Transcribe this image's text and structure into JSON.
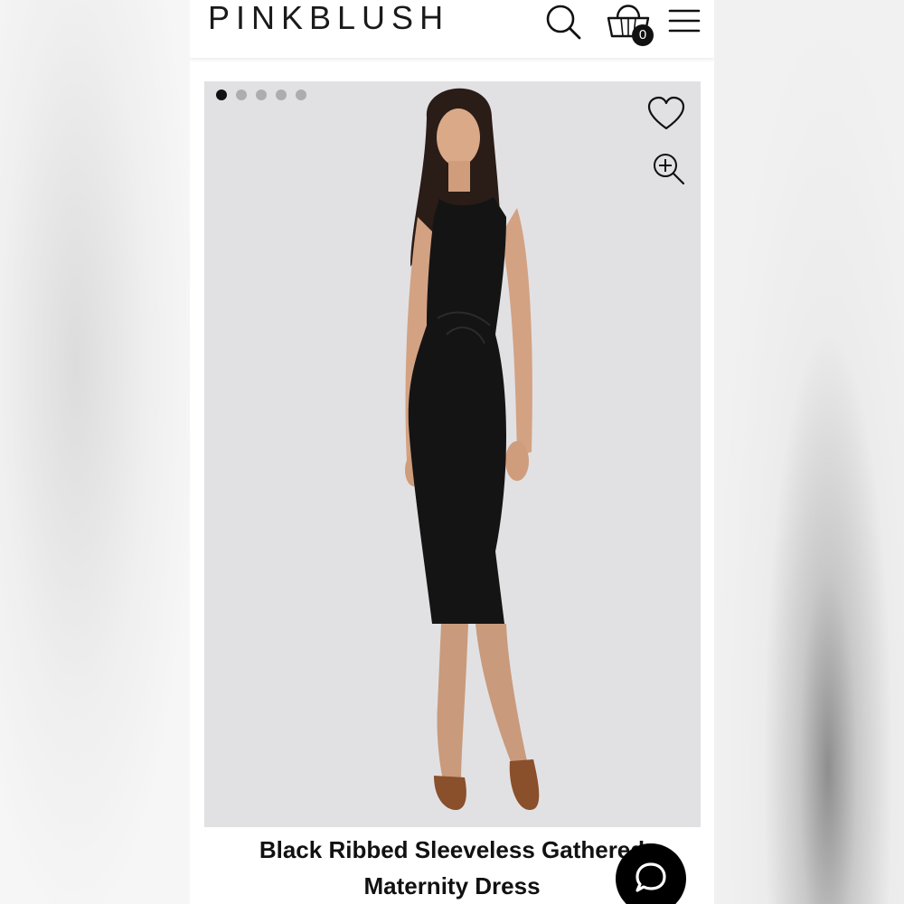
{
  "header": {
    "logo": "PINKBLUSH",
    "cart_count": "0",
    "icons": [
      "search-icon",
      "shopping-bag-icon",
      "hamburger-menu-icon"
    ]
  },
  "gallery": {
    "image_count": 5,
    "active_image": 1,
    "icons": [
      "heart-icon",
      "zoom-in-icon"
    ],
    "background_color": "#e1e1e4"
  },
  "product": {
    "title_line1": "Black Ribbed Sleeveless Gathered",
    "title_line2": "Maternity Dress"
  },
  "chat": {
    "icon": "chat-bubble-icon",
    "color": "#000000"
  }
}
